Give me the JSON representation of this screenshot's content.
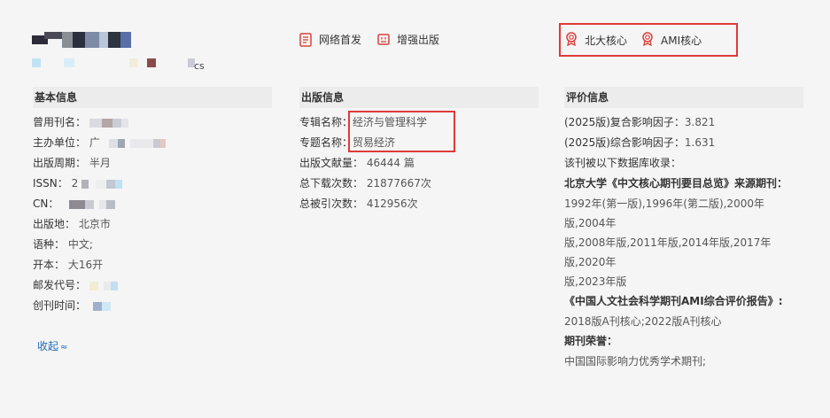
{
  "header": {
    "subtitle_tail": "cs",
    "tags": [
      {
        "label": "网络首发",
        "icon": "document-icon"
      },
      {
        "label": "增强出版",
        "icon": "media-icon"
      }
    ],
    "cores": [
      {
        "label": "北大核心",
        "icon": "award-icon"
      },
      {
        "label": "AMI核心",
        "icon": "award-icon"
      }
    ]
  },
  "basic": {
    "title": "基本信息",
    "rows": [
      {
        "key": "曾用刊名：",
        "value": ""
      },
      {
        "key": "主办单位：",
        "value": "广"
      },
      {
        "key": "出版周期：",
        "value": "半月"
      },
      {
        "key": "ISSN：",
        "value": "2"
      },
      {
        "key": "CN：",
        "value": ""
      },
      {
        "key": "出版地：",
        "value": "北京市"
      },
      {
        "key": "语种：",
        "value": "中文;"
      },
      {
        "key": "开本：",
        "value": "大16开"
      },
      {
        "key": "邮发代号：",
        "value": ""
      },
      {
        "key": "创刊时间：",
        "value": ""
      }
    ],
    "collapse_label": "收起",
    "collapse_icon": "double-chevron-up-icon"
  },
  "publish": {
    "title": "出版信息",
    "rows": [
      {
        "key": "专辑名称：",
        "value": "经济与管理科学"
      },
      {
        "key": "专题名称：",
        "value": "贸易经济"
      },
      {
        "key": "出版文献量：",
        "value": "46444 篇"
      },
      {
        "key": "总下载次数：",
        "value": "21877667次"
      },
      {
        "key": "总被引次数：",
        "value": "412956次"
      }
    ]
  },
  "evaluation": {
    "title": "评价信息",
    "if_composite_label": "(2025版)复合影响因子：",
    "if_composite_value": "3.821",
    "if_comprehensive_label": "(2025版)综合影响因子：",
    "if_comprehensive_value": "1.631",
    "db_label": "该刊被以下数据库收录：",
    "pku_label": "北京大学《中文核心期刊要目总览》来源期刊：",
    "pku_line1": "1992年(第一版),1996年(第二版),2000年版,2004年",
    "pku_line2": "版,2008年版,2011年版,2014年版,2017年版,2020年",
    "pku_line3": "版,2023年版",
    "ami_label": "《中国人文社会科学期刊AMI综合评价报告》:",
    "ami_value": "2018版A刊核心;2022版A刊核心",
    "honor_label": "期刊荣誉：",
    "honor_value": "中国国际影响力优秀学术期刊;"
  },
  "colors": {
    "highlight_border": "#e03a3a",
    "icon_red": "#d9403a",
    "link_blue": "#1e6ab8"
  }
}
